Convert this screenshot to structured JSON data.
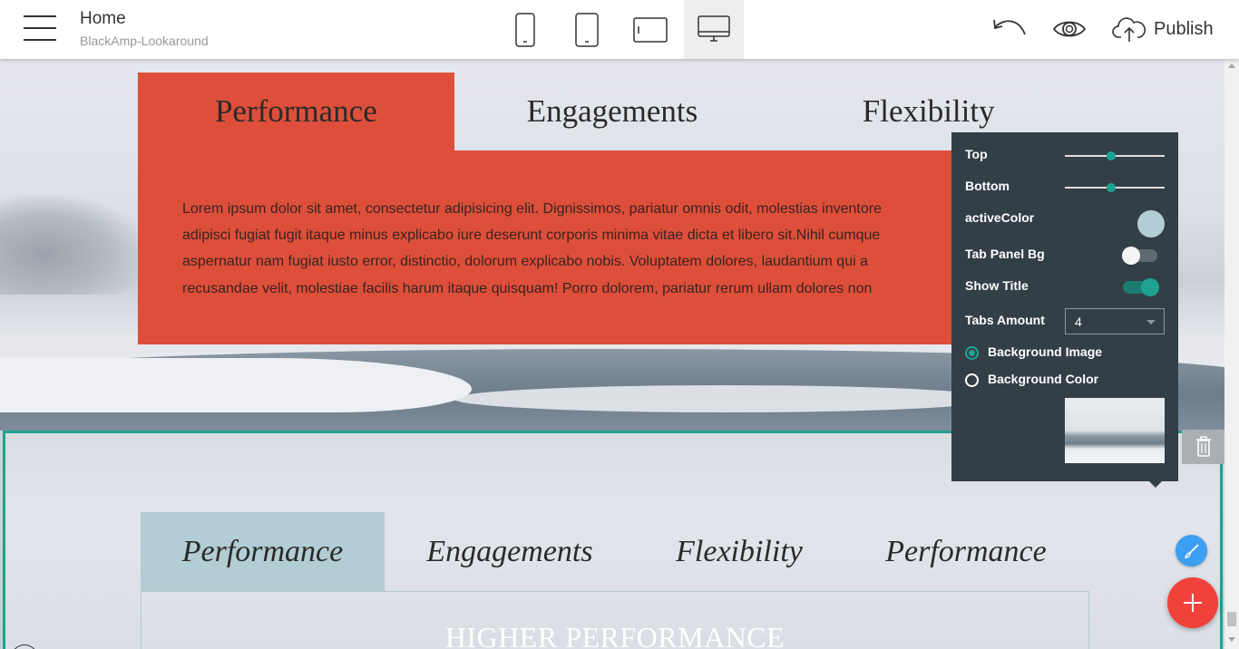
{
  "header": {
    "page_title": "Home",
    "project_name": "BlackAmp-Lookaround",
    "publish_label": "Publish",
    "devices": [
      "mobile",
      "tablet",
      "tablet-landscape",
      "desktop"
    ],
    "active_device": "desktop"
  },
  "section1": {
    "tabs": [
      "Performance",
      "Engagements",
      "Flexibility"
    ],
    "active_tab": 0,
    "accent_color": "#dd4f3a",
    "body_lines": [
      "Lorem ipsum dolor sit amet, consectetur adipisicing elit. Dignissimos, pariatur omnis odit, molestias inventore",
      "adipisci fugiat fugit itaque minus explicabo iure deserunt corporis minima vitae dicta et libero sit.Nihil cumque",
      "aspernatur nam fugiat iusto error, distinctio, dolorum explicabo nobis. Voluptatem dolores, laudantium qui a",
      "recusandae velit, molestiae facilis harum itaque quisquam! Porro dolorem, pariatur rerum ullam dolores non"
    ]
  },
  "section2": {
    "tabs": [
      "Performance",
      "Engagements",
      "Flexibility",
      "Performance"
    ],
    "active_tab": 0,
    "active_color": "#b2cdd3",
    "panel_heading": "HIGHER PERFORMANCE"
  },
  "settings": {
    "top_label": "Top",
    "top_value": 0.46,
    "bottom_label": "Bottom",
    "bottom_value": 0.46,
    "active_color_label": "activeColor",
    "active_color": "#b2cdd3",
    "tab_panel_bg_label": "Tab Panel Bg",
    "tab_panel_bg_on": false,
    "show_title_label": "Show Title",
    "show_title_on": true,
    "tabs_amount_label": "Tabs Amount",
    "tabs_amount_value": "4",
    "background_image_label": "Background Image",
    "background_color_label": "Background Color",
    "background_mode": "image"
  },
  "colors": {
    "accent_teal": "#1fa291",
    "panel_dark": "#333f47",
    "fab_blue": "#3d9ff2",
    "fab_red": "#f1413b"
  }
}
